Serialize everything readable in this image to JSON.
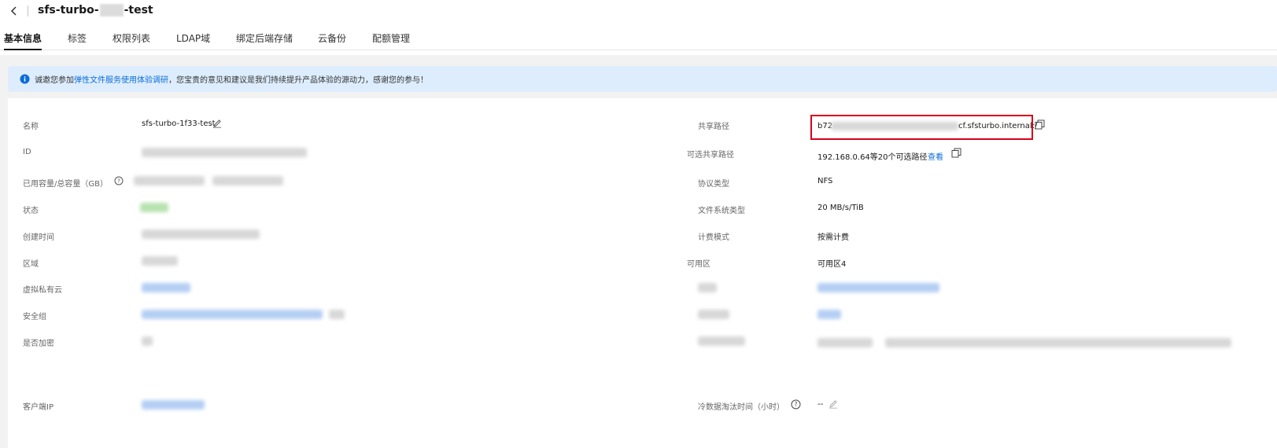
{
  "header": {
    "title_prefix": "sfs-turbo-",
    "title_suffix": "-test"
  },
  "tabs": [
    {
      "label": "基本信息"
    },
    {
      "label": "标签"
    },
    {
      "label": "权限列表"
    },
    {
      "label": "LDAP域"
    },
    {
      "label": "绑定后端存储"
    },
    {
      "label": "云备份"
    },
    {
      "label": "配额管理"
    }
  ],
  "notice": {
    "prefix": "诚邀您参加",
    "link": "弹性文件服务使用体验调研",
    "suffix": "，您宝贵的意见和建议是我们持续提升产品体验的源动力，感谢您的参与！"
  },
  "left": {
    "name_label": "名称",
    "name_value": "sfs-turbo-1f33-test",
    "id_label": "ID",
    "capacity_label": "已用容量/总容量（GB）",
    "status_label": "状态",
    "created_label": "创建时间",
    "region_label": "区域",
    "vpc_label": "虚拟私有云",
    "secgroup_label": "安全组",
    "encrypt_label": "是否加密",
    "client_ip_label": "客户端IP"
  },
  "right": {
    "share_path_label": "共享路径",
    "share_path_prefix": "b72",
    "share_path_suffix": "cf.sfsturbo.internal:/",
    "optional_path_label": "可选共享路径",
    "optional_path_value": "192.168.0.64等20个可选路径",
    "optional_path_link": "查看",
    "protocol_label": "协议类型",
    "protocol_value": "NFS",
    "fs_type_label": "文件系统类型",
    "fs_type_value": "20 MB/s/TiB",
    "billing_label": "计费模式",
    "billing_value": "按需计费",
    "az_label": "可用区",
    "az_value": "可用区4",
    "cold_label": "冷数据淘汰时间（小时）",
    "cold_value": "--"
  }
}
